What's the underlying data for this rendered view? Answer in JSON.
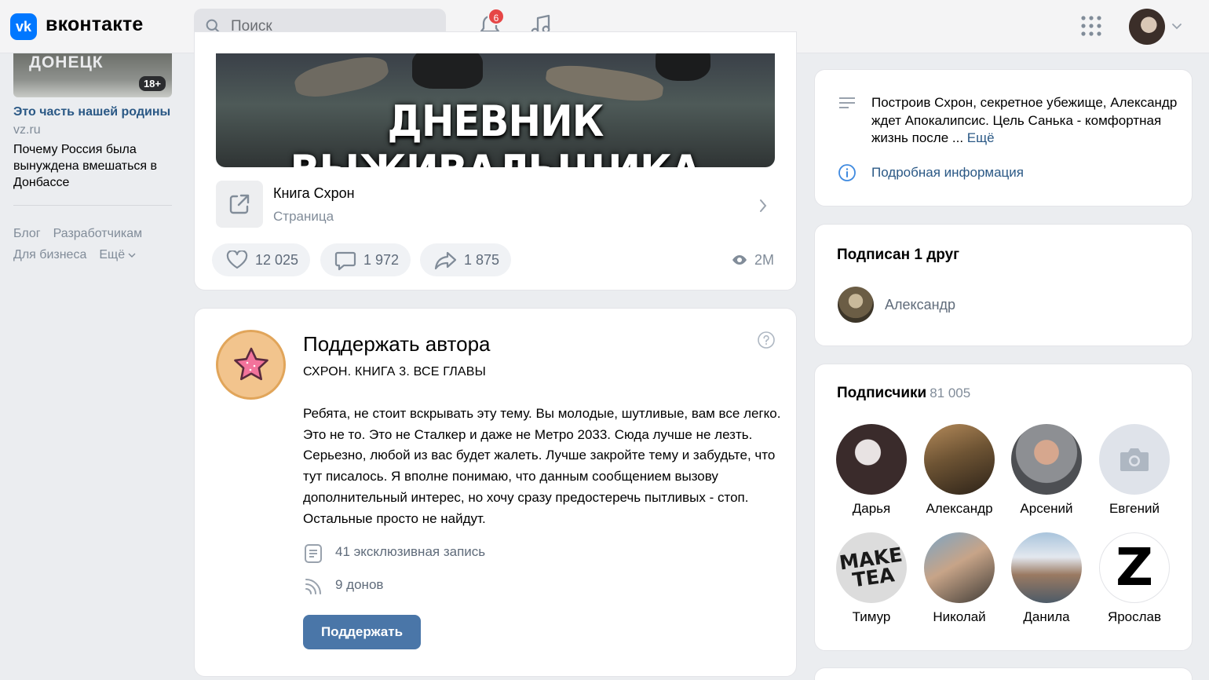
{
  "header": {
    "logo_glyph": "vk",
    "app_name": "вконтакте",
    "search_placeholder": "Поиск",
    "notifications_count": "6",
    "icons": [
      "search-icon",
      "bell-icon",
      "music-icon",
      "apps-grid-icon",
      "chevron-down-icon"
    ]
  },
  "sidebar": {
    "ad": {
      "image_text": "ДОНЕЦК",
      "age_rating": "18+",
      "title": "Это часть нашей родины",
      "domain": "vz.ru",
      "description": "Почему Россия была вынуждена вмешаться в Донбассе"
    },
    "footer_links": [
      "Блог",
      "Разработчикам",
      "Для бизнеса",
      "Ещё"
    ]
  },
  "post": {
    "image_title": "ДНЕВНИК ВЫЖИВАЛЬЩИКА",
    "attachment": {
      "title": "Книга Схрон",
      "subtitle": "Страница"
    },
    "likes": "12 025",
    "comments": "1 972",
    "shares": "1 875",
    "views": "2M"
  },
  "donut": {
    "title": "Поддержать автора",
    "subtitle": "СХРОН. КНИГА 3. ВСЕ ГЛАВЫ",
    "body": "Ребята, не стоит вскрывать эту тему. Вы молодые, шутливые, вам все легко. Это не то. Это не Сталкер и даже не Метро 2033. Сюда лучше не лезть. Серьезно, любой из вас будет жалеть. Лучше закройте тему и забудьте, что тут писалось. Я вполне понимаю, что данным сообщением вызову дополнительный интерес, но хочу сразу предостеречь пытливых - стоп. Остальные просто не найдут.",
    "exclusive_posts": "41 эксклюзивная запись",
    "donors": "9 донов",
    "button_label": "Поддержать"
  },
  "info": {
    "description": "Построив Схрон, секретное убежище, Александр ждет Апокалипсис. Цель Санька - комфортная жизнь после ...",
    "more_label": "Ещё",
    "details_link": "Подробная информация"
  },
  "friends": {
    "title": "Подписан 1 друг",
    "items": [
      {
        "name": "Александр"
      }
    ]
  },
  "subscribers": {
    "title": "Подписчики",
    "count": "81 005",
    "items": [
      {
        "name": "Дарья"
      },
      {
        "name": "Александр"
      },
      {
        "name": "Арсений"
      },
      {
        "name": "Евгений"
      },
      {
        "name": "Тимур",
        "avatar_text": "MAKE TEA"
      },
      {
        "name": "Николай"
      },
      {
        "name": "Данила"
      },
      {
        "name": "Ярослав",
        "avatar_text": "Z"
      }
    ]
  },
  "colors": {
    "accent_blue": "#0077ff",
    "link_blue": "#2a5885",
    "button_blue": "#4a76a8",
    "badge_red": "#e64646",
    "page_bg": "#ebedf0"
  }
}
